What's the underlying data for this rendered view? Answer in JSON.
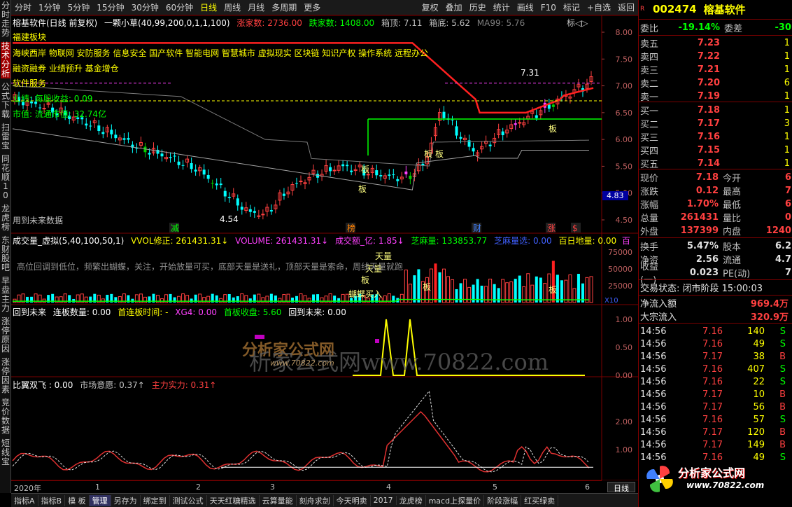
{
  "topbar": {
    "left_items": [
      "分时",
      "1分钟",
      "5分钟",
      "15分钟",
      "30分钟",
      "60分钟",
      "日线",
      "周线",
      "月线",
      "多周期",
      "更多"
    ],
    "active": "日线",
    "right_items": [
      "复权",
      "叠加",
      "历史",
      "统计",
      "画线",
      "F10",
      "标记",
      "+自选",
      "返回"
    ]
  },
  "leftnav": [
    "分时走势",
    "技术分析",
    "公式下载",
    "扫雷宝",
    "同花顺10",
    "龙虎榜",
    "东财股吧",
    "早盘主力",
    "涨停原因",
    "涨停因素",
    "竞价数据",
    "短线宝"
  ],
  "leftnav_active": "技术分析",
  "main_panel": {
    "stock_label": "榕基软件(日线 前复权)",
    "indicator_name": "一颗小草(40,99,200,0,1,1,100)",
    "rise_count_label": "涨家数: 2736.00",
    "fall_count_label": "跌家数: 1408.00",
    "box_top_label": "箱顶: 7.11",
    "box_bottom_label": "箱底: 5.62",
    "ma99_label": "MA99: 5.76",
    "tag_close": "标◁▷",
    "sector_title": "福建板块",
    "concepts_line1": "海峡西岸 物联网 安防服务 信息安全 国产软件 智能电网 智慧城市 虚拟现实 区块链 知识产权 操作系统 远程办公",
    "concepts_line2": "融资融券 业绩预升 基金增仓",
    "industry": "软件服务",
    "business_line": "业绩: 每股收益: 0.09",
    "market_value": "市值: 流通市值: 32.74亿",
    "future_note": "用到未来数据",
    "high_label": "7.31",
    "low_label": "4.54",
    "current_price_tag": "4.83",
    "board_labels": [
      "板",
      "板",
      "板",
      "板",
      "板"
    ],
    "event_tags": [
      "减",
      "榜",
      "财",
      "涨",
      "$"
    ],
    "y_ticks": [
      "8.00",
      "7.50",
      "7.00",
      "6.50",
      "6.00",
      "5.50",
      "5.00",
      "4.50"
    ]
  },
  "volume_panel": {
    "title": "成交量_虚拟(5,40,100,50,1)",
    "vvol": "VVOL修正: 261431.31↓",
    "volume": "VOLUME: 261431.31↓",
    "amount": "成交额_亿: 1.85↓",
    "sesame": "芝麻量: 133853.77",
    "sesame_select": "芝麻量选: 0.00",
    "hundred_low": "百日地量: 0.00",
    "hundred_tag": "百",
    "advice_text": "高位回调到低位，频繁出蝴蝶，关注，开始放量可买，底部天量是送礼，顶部天量是索命，周线天量就跑",
    "tags": [
      "天量",
      "天量",
      "板",
      "板",
      "板",
      "蝴蝶买入"
    ],
    "y_ticks": [
      "75000",
      "50000",
      "25000"
    ],
    "unit": "X10"
  },
  "future_panel": {
    "title": "回到未来",
    "lianban": "连板数量: 0.00",
    "first_time": "首连板时间: -",
    "xg4": "XG4: 0.00",
    "first_close": "首板收盘: 5.60",
    "back_future": "回到未来: 0.00",
    "y_ticks": [
      "1.00",
      "0.50",
      "0.00"
    ]
  },
  "wing_panel": {
    "title": "比翼双飞 : 0.00",
    "market_will": "市场意愿: 0.37↑",
    "main_power": "主力实力: 0.31↑",
    "y_ticks": [
      "2.00",
      "1.00"
    ]
  },
  "watermark": {
    "logo_text": "分析家公式网",
    "url_large": "析家公式网www.70822.com",
    "url_small": "www.70822.com"
  },
  "time_axis": {
    "labels": [
      "2020年",
      "1",
      "2",
      "3",
      "4",
      "5",
      "6"
    ],
    "right_btn": "日线"
  },
  "right": {
    "code": "002474",
    "name": "榕基软件",
    "r_mark": "R",
    "weibi_label": "委比",
    "weibi": "-19.14%",
    "weicha_label": "委差",
    "weicha": "-30",
    "asks": [
      {
        "label": "卖五",
        "price": "7.23",
        "vol": "1"
      },
      {
        "label": "卖四",
        "price": "7.22",
        "vol": "1"
      },
      {
        "label": "卖三",
        "price": "7.21",
        "vol": "1"
      },
      {
        "label": "卖二",
        "price": "7.20",
        "vol": "6"
      },
      {
        "label": "卖一",
        "price": "7.19",
        "vol": "1"
      }
    ],
    "bids": [
      {
        "label": "买一",
        "price": "7.18",
        "vol": "1"
      },
      {
        "label": "买二",
        "price": "7.17",
        "vol": "3"
      },
      {
        "label": "买三",
        "price": "7.16",
        "vol": "1"
      },
      {
        "label": "买四",
        "price": "7.15",
        "vol": "1"
      },
      {
        "label": "买五",
        "price": "7.14",
        "vol": "1"
      }
    ],
    "stats": [
      {
        "l1": "现价",
        "v1": "7.18",
        "l2": "今开",
        "v2": "6"
      },
      {
        "l1": "涨跌",
        "v1": "0.12",
        "l2": "最高",
        "v2": "7"
      },
      {
        "l1": "涨幅",
        "v1": "1.70%",
        "l2": "最低",
        "v2": "6"
      },
      {
        "l1": "总量",
        "v1": "261431",
        "l2": "量比",
        "v2": "0"
      },
      {
        "l1": "外盘",
        "v1": "137399",
        "l2": "内盘",
        "v2": "1240"
      }
    ],
    "stats2": [
      {
        "l1": "换手",
        "v1": "5.47%",
        "l2": "股本",
        "v2": "6.2"
      },
      {
        "l1": "净资",
        "v1": "2.56",
        "l2": "流通",
        "v2": "4.7"
      },
      {
        "l1": "收益(一)",
        "v1": "0.023",
        "l2": "PE(动)",
        "v2": "7"
      }
    ],
    "trade_status": "交易状态: 闭市阶段 15:00:03",
    "net_inflow_label": "净流入额",
    "net_inflow": "969.4万",
    "big_inflow_label": "大宗流入",
    "big_inflow": "320.9万",
    "ticks": [
      {
        "t": "14:56",
        "p": "7.16",
        "v": "140",
        "s": "S"
      },
      {
        "t": "14:56",
        "p": "7.16",
        "v": "49",
        "s": "S"
      },
      {
        "t": "14:56",
        "p": "7.17",
        "v": "38",
        "s": "B"
      },
      {
        "t": "14:56",
        "p": "7.16",
        "v": "407",
        "s": "S"
      },
      {
        "t": "14:56",
        "p": "7.16",
        "v": "22",
        "s": "S"
      },
      {
        "t": "14:56",
        "p": "7.17",
        "v": "10",
        "s": "B"
      },
      {
        "t": "14:56",
        "p": "7.17",
        "v": "56",
        "s": "B"
      },
      {
        "t": "14:56",
        "p": "7.16",
        "v": "57",
        "s": "S"
      },
      {
        "t": "14:56",
        "p": "7.17",
        "v": "120",
        "s": "B"
      },
      {
        "t": "14:56",
        "p": "7.17",
        "v": "149",
        "s": "B"
      },
      {
        "t": "14:56",
        "p": "7.16",
        "v": "49",
        "s": "S"
      }
    ],
    "logo_text": "分析家公式网",
    "logo_url": "www.70822.com"
  },
  "bottombar": [
    "指标A",
    "指标B",
    "模 板",
    "管理",
    "另存为",
    "绑定到",
    "测试公式",
    "天天红糖精选",
    "云算量能",
    "刻舟求剑",
    "今天明卖",
    "2017",
    "龙虎榜",
    "macd上探量价",
    "阶段涨幅",
    "红买绿卖"
  ],
  "bottombar_active": "管理",
  "colors": {
    "up": "#ff4040",
    "down": "#00ffff",
    "border": "#7a0000",
    "ma_red": "#ff2020",
    "ma_gray": "#909090",
    "yellow": "#ffff00",
    "green": "#00ff00",
    "magenta": "#ff40ff"
  }
}
